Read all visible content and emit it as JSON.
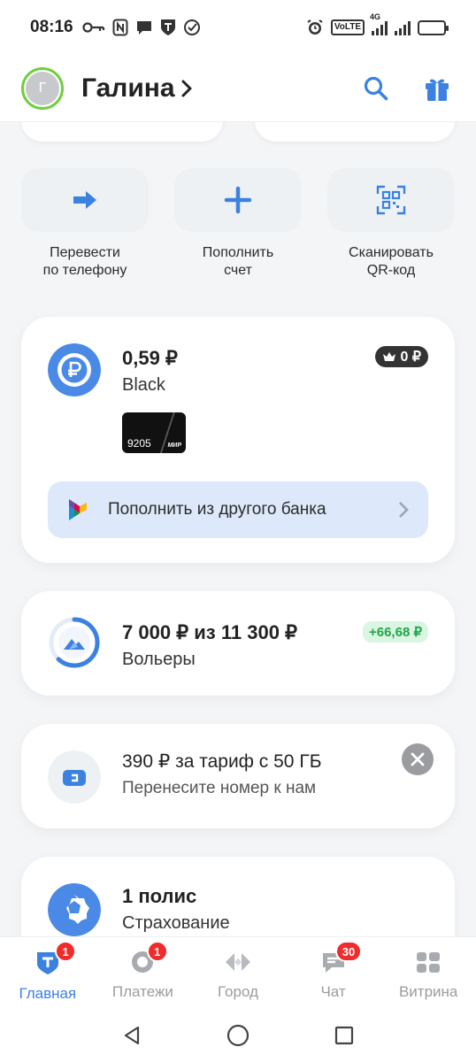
{
  "status_bar": {
    "time": "08:16",
    "left_icons": [
      "key-icon",
      "nfc-icon",
      "chat-icon",
      "tinkoff-shield-icon",
      "check-circle-icon"
    ],
    "right_icons": [
      "alarm-icon",
      "volte-icon",
      "signal-4g-icon",
      "signal-icon",
      "battery-icon"
    ],
    "volte": "VoLTE",
    "net": "4G"
  },
  "header": {
    "avatar_letter": "Г",
    "user_name": "Галина",
    "chevron": "›",
    "search_icon": "search-icon",
    "gift_icon": "gift-icon"
  },
  "quick_actions": [
    {
      "label": "Перевести\nпо телефону",
      "icon": "arrow-right-icon"
    },
    {
      "label": "Пополнить\nсчет",
      "icon": "plus-icon"
    },
    {
      "label": "Сканировать\nQR-код",
      "icon": "qr-scan-icon"
    }
  ],
  "account_card": {
    "amount": "0,59 ₽",
    "name": "Black",
    "cashback_badge": "0 ₽",
    "card_number": "9205",
    "card_system": "МИР",
    "topup_label": "Пополнить из другого банка",
    "chevron": "›"
  },
  "savings_card": {
    "amount": "7 000 ₽ из 11 300 ₽",
    "name": "Вольеры",
    "delta": "+66,68 ₽",
    "progress": 0.62
  },
  "tariff_card": {
    "title": "390 ₽ за тариф с 50 ГБ",
    "subtitle": "Перенесите номер к нам"
  },
  "insurance_card": {
    "title": "1 полис",
    "subtitle": "Страхование"
  },
  "tabbar": [
    {
      "label": "Главная",
      "icon": "home-t-icon",
      "badge": "1",
      "active": true
    },
    {
      "label": "Платежи",
      "icon": "payments-icon",
      "badge": "1",
      "active": false
    },
    {
      "label": "Город",
      "icon": "city-icon",
      "badge": "",
      "active": false
    },
    {
      "label": "Чат",
      "icon": "chat-icon",
      "badge": "30",
      "active": false
    },
    {
      "label": "Витрина",
      "icon": "showcase-icon",
      "badge": "",
      "active": false
    }
  ],
  "colors": {
    "accent": "#3b82e0",
    "avatar_ring": "#6fcf3d",
    "positive": "#1fa84a",
    "badge_red": "#ef2b2b"
  }
}
